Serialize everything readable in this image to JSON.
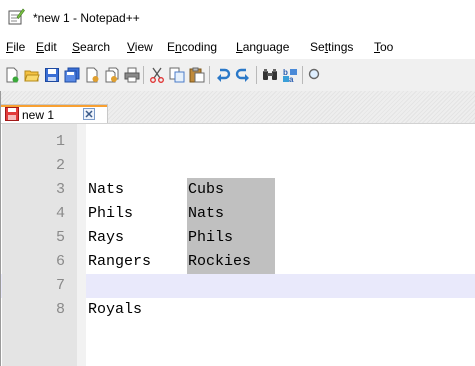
{
  "window": {
    "title": "*new 1 - Notepad++"
  },
  "menu": [
    {
      "pre": "",
      "u": "F",
      "post": "ile"
    },
    {
      "pre": "",
      "u": "E",
      "post": "dit"
    },
    {
      "pre": "",
      "u": "S",
      "post": "earch"
    },
    {
      "pre": "",
      "u": "V",
      "post": "iew"
    },
    {
      "pre": "E",
      "u": "n",
      "post": "coding"
    },
    {
      "pre": "",
      "u": "L",
      "post": "anguage"
    },
    {
      "pre": "Se",
      "u": "t",
      "post": "tings"
    },
    {
      "pre": "",
      "u": "T",
      "post": "oo"
    }
  ],
  "tab": {
    "label": "new 1"
  },
  "editor": {
    "lines": [
      {
        "num": "1",
        "col1": "",
        "col2": ""
      },
      {
        "num": "2",
        "col1": "",
        "col2": ""
      },
      {
        "num": "3",
        "col1": "Nats",
        "col2": "Cubs"
      },
      {
        "num": "4",
        "col1": "Phils",
        "col2": "Nats"
      },
      {
        "num": "5",
        "col1": "Rays",
        "col2": "Phils"
      },
      {
        "num": "6",
        "col1": "Rangers",
        "col2": "Rockies"
      },
      {
        "num": "7",
        "col1": "",
        "col2": ""
      },
      {
        "num": "8",
        "col1": "Royals",
        "col2": ""
      }
    ],
    "current_line": "6"
  },
  "colors": {
    "selection": "#c0c0c0",
    "current_line": "#e9e9fb",
    "tab_accent": "#f8a032"
  }
}
